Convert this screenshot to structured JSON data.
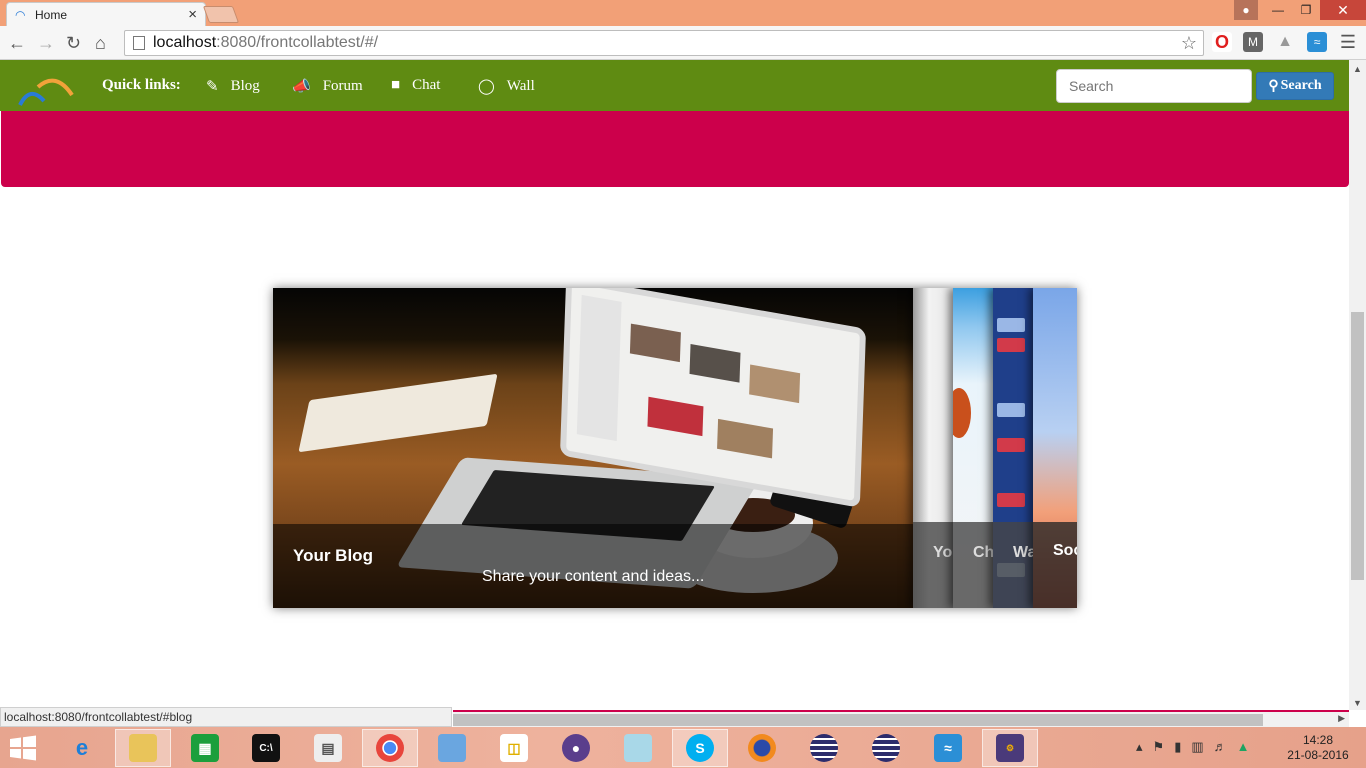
{
  "browser": {
    "tab_title": "Home",
    "tab_close": "×",
    "address_host": "localhost",
    "address_path": ":8080/frontcollabtest/#/",
    "status_url": "localhost:8080/frontcollabtest/#blog"
  },
  "navbar": {
    "quick_links_label": "Quick links:",
    "links": [
      {
        "label": "Blog",
        "icon": "pencil-icon"
      },
      {
        "label": "Forum",
        "icon": "bullhorn-icon"
      },
      {
        "label": "Chat",
        "icon": "comment-icon"
      },
      {
        "label": "Wall",
        "icon": "dashboard-icon"
      }
    ],
    "search_placeholder": "Search",
    "search_button": "Search"
  },
  "slider": {
    "main": {
      "title": "Your Blog",
      "subtitle": "Share your content and ideas..."
    },
    "strips": [
      {
        "label": "Yo"
      },
      {
        "label": "Ch"
      },
      {
        "label": "Wa"
      },
      {
        "label": "Soc"
      }
    ]
  },
  "taskbar": {
    "time": "14:28",
    "date": "21-08-2016"
  },
  "colors": {
    "navbar": "#5f8b12",
    "banner": "#cc004b",
    "search_button": "#337ab7"
  }
}
